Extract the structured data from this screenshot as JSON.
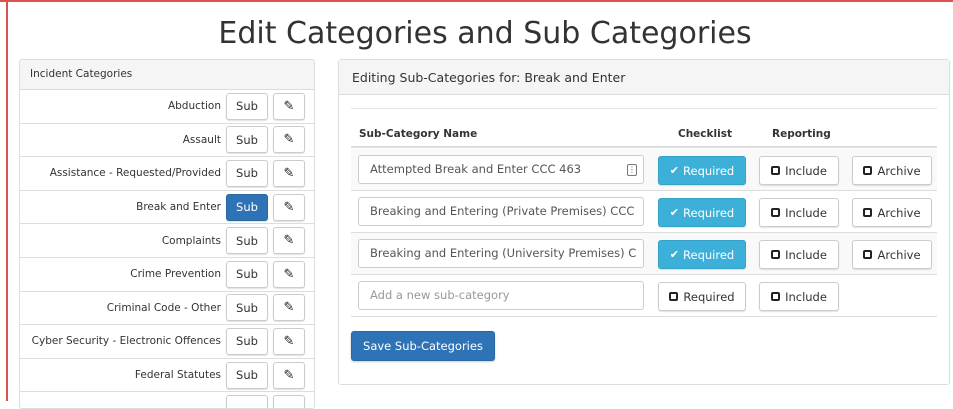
{
  "page": {
    "title": "Edit Categories and Sub Categories"
  },
  "left_panel": {
    "heading": "Incident Categories",
    "sub_label": "Sub",
    "categories": [
      {
        "label": "Abduction",
        "active": false
      },
      {
        "label": "Assault",
        "active": false
      },
      {
        "label": "Assistance - Requested/Provided",
        "active": false
      },
      {
        "label": "Break and Enter",
        "active": true
      },
      {
        "label": "Complaints",
        "active": false
      },
      {
        "label": "Crime Prevention",
        "active": false
      },
      {
        "label": "Criminal Code - Other",
        "active": false
      },
      {
        "label": "Cyber Security - Electronic Offences",
        "active": false
      },
      {
        "label": "Federal Statutes",
        "active": false
      }
    ]
  },
  "right_panel": {
    "heading": "Editing Sub-Categories for: Break and Enter",
    "columns": {
      "name": "Sub-Category Name",
      "checklist": "Checklist",
      "reporting": "Reporting"
    },
    "required_label": "Required",
    "include_label": "Include",
    "archive_label": "Archive",
    "rows": [
      {
        "value": "Attempted Break and Enter CCC 463",
        "required": true
      },
      {
        "value": "Breaking and Entering (Private Premises) CCC",
        "required": true
      },
      {
        "value": "Breaking and Entering (University Premises) C",
        "required": true
      }
    ],
    "new_row": {
      "placeholder": "Add a new sub-category",
      "required_label": "Required",
      "include_label": "Include"
    },
    "save_label": "Save Sub-Categories"
  },
  "colors": {
    "primary": "#2e73b6",
    "info": "#3cb0d8",
    "frame": "#d9534f"
  }
}
